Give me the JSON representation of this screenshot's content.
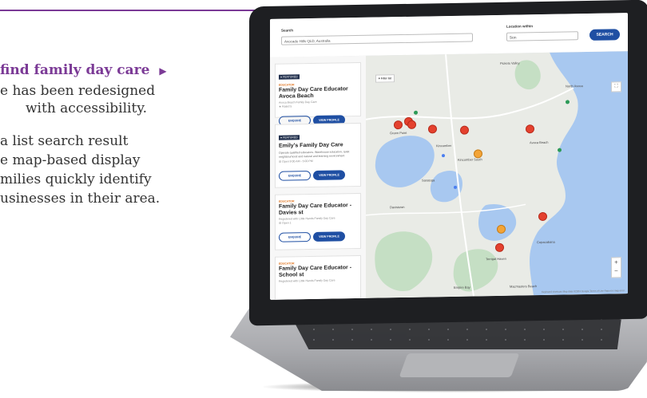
{
  "promo": {
    "heading": "find family day care",
    "lines": [
      "e has been redesigned",
      "with accessibility.",
      "a list search result",
      "e map-based display",
      "milies quickly identify",
      "usinesses in their area."
    ]
  },
  "app": {
    "search_label": "Search",
    "search_value": "Avocado Hills QLD, Australia",
    "location_label": "Location within",
    "location_value": "5km",
    "search_button": "SEARCH"
  },
  "cards": [
    {
      "badge": "● FEATURED",
      "tag": "EDUCATOR",
      "title": "Family Day Care Educator Avoca Beach",
      "subtitle": "Avoca Beach Family Day Care",
      "meta": "★ Rated 5",
      "desc": "",
      "enquire": "ENQUIRE",
      "view": "VIEW PROFILE"
    },
    {
      "badge": "● FEATURED",
      "tag": "",
      "title": "Emily's Family Day Care",
      "subtitle": "",
      "meta": "☰ Open 9:00 AM - 5:00 PM",
      "desc": "Operate qualified educators. Warehouse education, quiet neighbourhood and natural and learning environment",
      "enquire": "ENQUIRE",
      "view": "VIEW PROFILE"
    },
    {
      "badge": "",
      "tag": "EDUCATOR",
      "title": "Family Day Care Educator - Davies st",
      "subtitle": "Registered with Little Hands Family Day Care",
      "meta": "☰ Open 1",
      "desc": "",
      "enquire": "ENQUIRE",
      "view": "VIEW PROFILE"
    },
    {
      "badge": "",
      "tag": "EDUCATOR",
      "title": "Family Day Care Educator - School st",
      "subtitle": "Registered with Little Hands Family Day Care",
      "meta": "",
      "desc": "",
      "enquire": "",
      "view": ""
    }
  ],
  "map": {
    "filter_chip": "≡ Filter list",
    "labels": [
      "Pickets Valley",
      "North Avoca",
      "Avoca Beach",
      "Kincumber",
      "Saratoga",
      "Davistown",
      "Empire Bay",
      "Terrigal Haven",
      "Copacabana",
      "Macmasters Beach",
      "Kincumber South",
      "Green Point"
    ],
    "attribution": "Keyboard shortcuts   Map data ©2024 Google   Terms of Use   Report a map error"
  }
}
